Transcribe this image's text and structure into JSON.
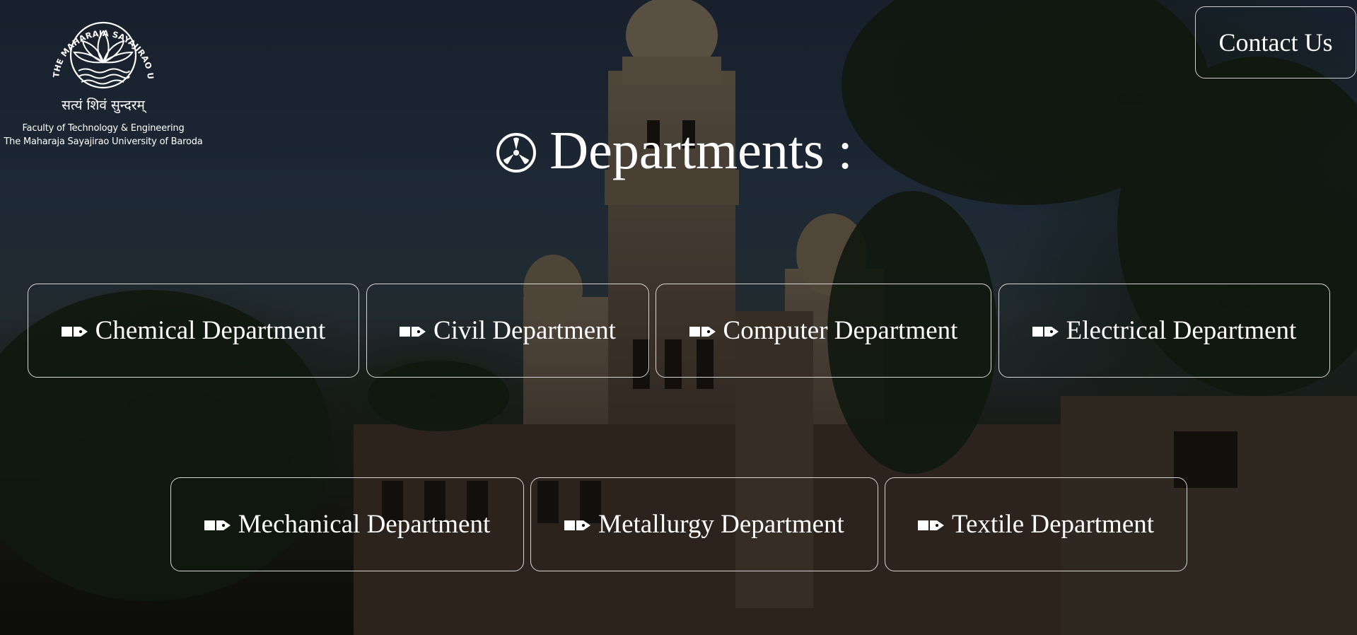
{
  "logo": {
    "motto": "सत्यं शिवं सुन्दरम्",
    "ring_text": "THE MAHARAJA SAYAJIRAO UNIVERSITY OF BARODA",
    "line1": "Faculty of Technology & Engineering",
    "line2": "The Maharaja Sayajirao University of Baroda"
  },
  "header": {
    "contact_label": "Contact Us"
  },
  "main": {
    "title": "Departments :",
    "title_icon": "propeller-circle-icon",
    "departments": [
      {
        "label": "Chemical Department",
        "icon": "pen-nib-icon"
      },
      {
        "label": "Civil Department",
        "icon": "pen-nib-icon"
      },
      {
        "label": "Computer Department",
        "icon": "pen-nib-icon"
      },
      {
        "label": "Electrical Department",
        "icon": "pen-nib-icon"
      },
      {
        "label": "Mechanical Department",
        "icon": "pen-nib-icon"
      },
      {
        "label": "Metallurgy Department",
        "icon": "pen-nib-icon"
      },
      {
        "label": "Textile Department",
        "icon": "pen-nib-icon"
      }
    ]
  },
  "colors": {
    "text": "#ffffff",
    "button_border": "#d6d6d6",
    "overlay": "#000000"
  }
}
